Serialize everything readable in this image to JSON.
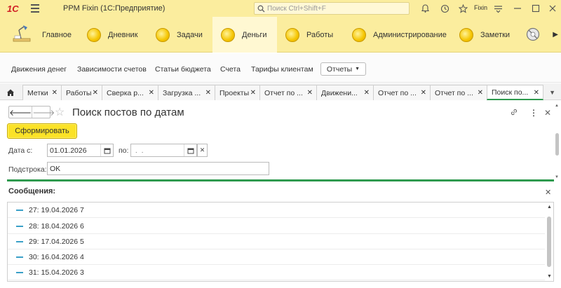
{
  "titlebar": {
    "logo": "1С",
    "app_title": "PPM Fixin  (1С:Предприятие)",
    "search_placeholder": "Поиск Ctrl+Shift+F",
    "user": "Fixin"
  },
  "sections": [
    {
      "label": "Главное"
    },
    {
      "label": "Дневник"
    },
    {
      "label": "Задачи"
    },
    {
      "label": "Деньги"
    },
    {
      "label": "Работы"
    },
    {
      "label": "Администрирование"
    },
    {
      "label": "Заметки"
    }
  ],
  "commands": [
    {
      "label": "Движения денег"
    },
    {
      "label": "Зависимости счетов"
    },
    {
      "label": "Статьи бюджета"
    },
    {
      "label": "Счета"
    },
    {
      "label": "Тарифы клиентам"
    }
  ],
  "reports_button": "Отчеты",
  "window_tabs": [
    {
      "label": "Метки"
    },
    {
      "label": "Работы"
    },
    {
      "label": "Сверка р..."
    },
    {
      "label": "Загрузка ..."
    },
    {
      "label": "Проекты"
    },
    {
      "label": "Отчет по ..."
    },
    {
      "label": "Движени..."
    },
    {
      "label": "Отчет по ..."
    },
    {
      "label": "Отчет по ..."
    },
    {
      "label": "Поиск по..."
    }
  ],
  "form": {
    "title": "Поиск постов по датам",
    "generate_button": "Сформировать",
    "date_from_label": "Дата с:",
    "date_from_value": "01.01.2026",
    "date_to_label": "по:",
    "date_to_value": " .  .",
    "substring_label": "Подстрока:",
    "substring_value": "OK"
  },
  "messages": {
    "title": "Сообщения:",
    "items": [
      "27: 19.04.2026 7",
      "28: 18.04.2026 6",
      "29: 17.04.2026 5",
      "30: 16.04.2026 4",
      "31: 15.04.2026 3"
    ]
  },
  "colors": {
    "panel_yellow": "#fbed9e",
    "accent_green": "#2e9a4e",
    "button_yellow": "#fbe227"
  }
}
